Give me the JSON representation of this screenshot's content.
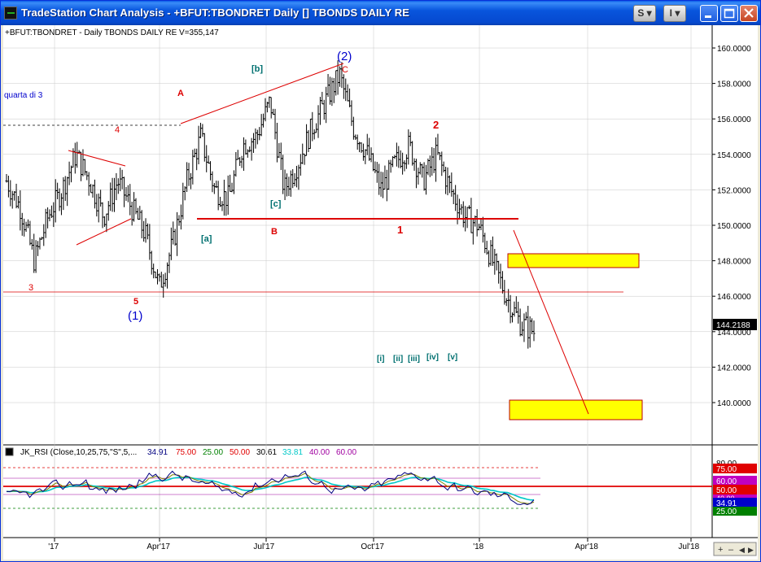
{
  "window": {
    "title": "TradeStation Chart Analysis - +BFUT:TBONDRET Daily [] TBONDS DAILY RE",
    "buttons": {
      "s_label": "S",
      "i_label": "I"
    }
  },
  "chart": {
    "header": "+BFUT:TBONDRET - Daily  TBONDS DAILY RE  V=355,147",
    "note": "quarta di 3",
    "last_price": "144.2188"
  },
  "price_axis": {
    "ticks": [
      "160.0000",
      "158.0000",
      "156.0000",
      "154.0000",
      "152.0000",
      "150.0000",
      "148.0000",
      "146.0000",
      "144.0000",
      "142.0000",
      "140.0000"
    ]
  },
  "time_axis": {
    "labels": [
      "'17",
      "Apr'17",
      "Jul'17",
      "Oct'17",
      "'18",
      "Apr'18",
      "Jul'18"
    ]
  },
  "annotations": {
    "wave_2_major": "(2)",
    "wave_1_major": "(1)",
    "label_A": "A",
    "label_C": "C",
    "label_B": "B",
    "label_b": "[b]",
    "label_a": "[a]",
    "label_c": "[c]",
    "label_3": "3",
    "label_4": "4",
    "label_5": "5",
    "label_1": "1",
    "label_2": "2",
    "sub_i": "[i]",
    "sub_ii": "[ii]",
    "sub_iii": "[iii]",
    "sub_iv": "[iv]",
    "sub_v": "[v]"
  },
  "indicator": {
    "name": "JK_RSI (Close,10,25,75,\"S\",5,...",
    "values": [
      "34.91",
      "75.00",
      "25.00",
      "50.00",
      "30.61",
      "33.81",
      "40.00",
      "60.00"
    ],
    "axis_top": "80.00",
    "levels": [
      "75.00",
      "60.00",
      "50.00",
      "40.00",
      "34.91",
      "25.00"
    ]
  },
  "colors": {
    "bars": "#000000",
    "wave_red": "#DD0000",
    "wave_teal": "#007070",
    "wave_blue": "#0000CC",
    "target_box": "#FFFF00",
    "rsi_line": "#000080",
    "rsi_cyan": "#00C8C8",
    "rsi_olive": "#808000"
  },
  "chart_data": {
    "type": "ohlc-bar",
    "symbol": "+BFUT:TBONDRET",
    "interval": "Daily",
    "y_range": [
      138.5,
      160.5
    ],
    "x_labels": [
      "'17",
      "Apr'17",
      "Jul'17",
      "Oct'17",
      "'18",
      "Apr'18",
      "Jul'18"
    ],
    "key_levels": [
      150.0,
      146.0,
      155.5
    ],
    "target_zones": [
      [
        147.6,
        148.4
      ],
      [
        139.2,
        140.0
      ]
    ],
    "closes_sample": [
      152.5,
      151.0,
      148.0,
      150.5,
      152.0,
      154.0,
      152.5,
      150.5,
      152.5,
      151.0,
      149.5,
      146.5,
      149.0,
      152.5,
      155.0,
      152.0,
      151.5,
      154.5,
      155.0,
      157.0,
      152.0,
      153.5,
      155.5,
      157.0,
      158.5,
      155.5,
      154.0,
      152.0,
      153.5,
      154.5,
      152.5,
      154.0,
      152.0,
      150.5,
      150.0,
      148.0,
      146.0,
      144.5,
      144.0
    ]
  }
}
